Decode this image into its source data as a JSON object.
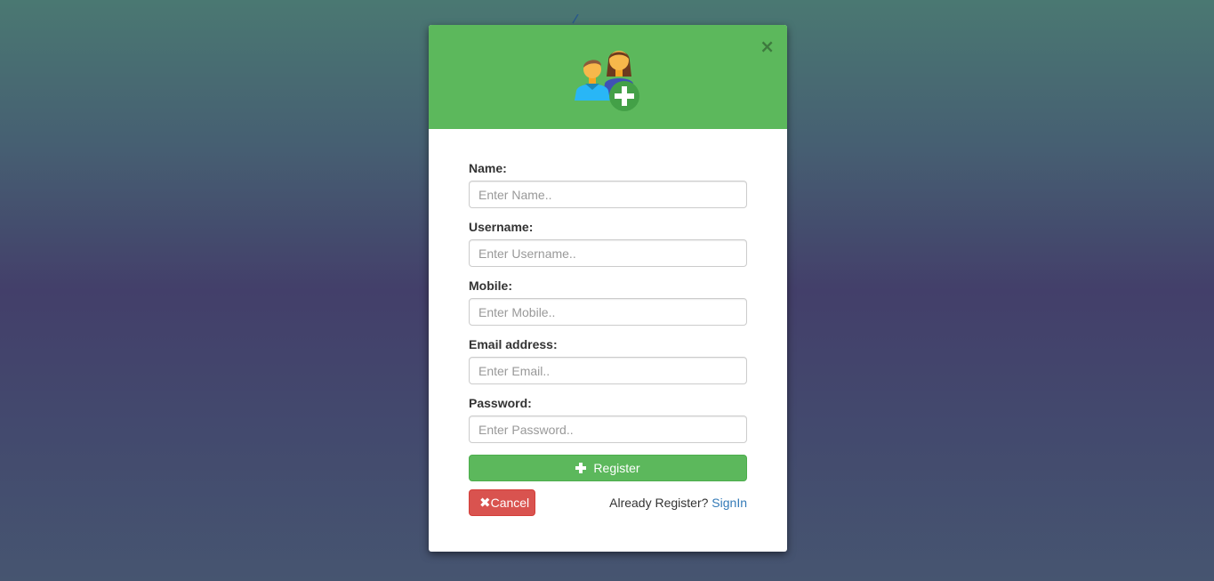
{
  "modal": {
    "close_label": "×",
    "header_icon": "users-add-icon",
    "colors": {
      "header": "#5cb85c",
      "register": "#5cb85c",
      "cancel": "#d9534f",
      "link": "#337ab7"
    }
  },
  "form": {
    "fields": [
      {
        "label": "Name:",
        "placeholder": "Enter Name..",
        "value": ""
      },
      {
        "label": "Username:",
        "placeholder": "Enter Username..",
        "value": ""
      },
      {
        "label": "Mobile:",
        "placeholder": "Enter Mobile..",
        "value": ""
      },
      {
        "label": "Email address:",
        "placeholder": "Enter Email..",
        "value": ""
      },
      {
        "label": "Password:",
        "placeholder": "Enter Password..",
        "value": ""
      }
    ],
    "register_label": "Register",
    "cancel_icon": "✖",
    "cancel_label": "Cancel",
    "already_text": "Already Register?",
    "signin_label": "SignIn"
  }
}
